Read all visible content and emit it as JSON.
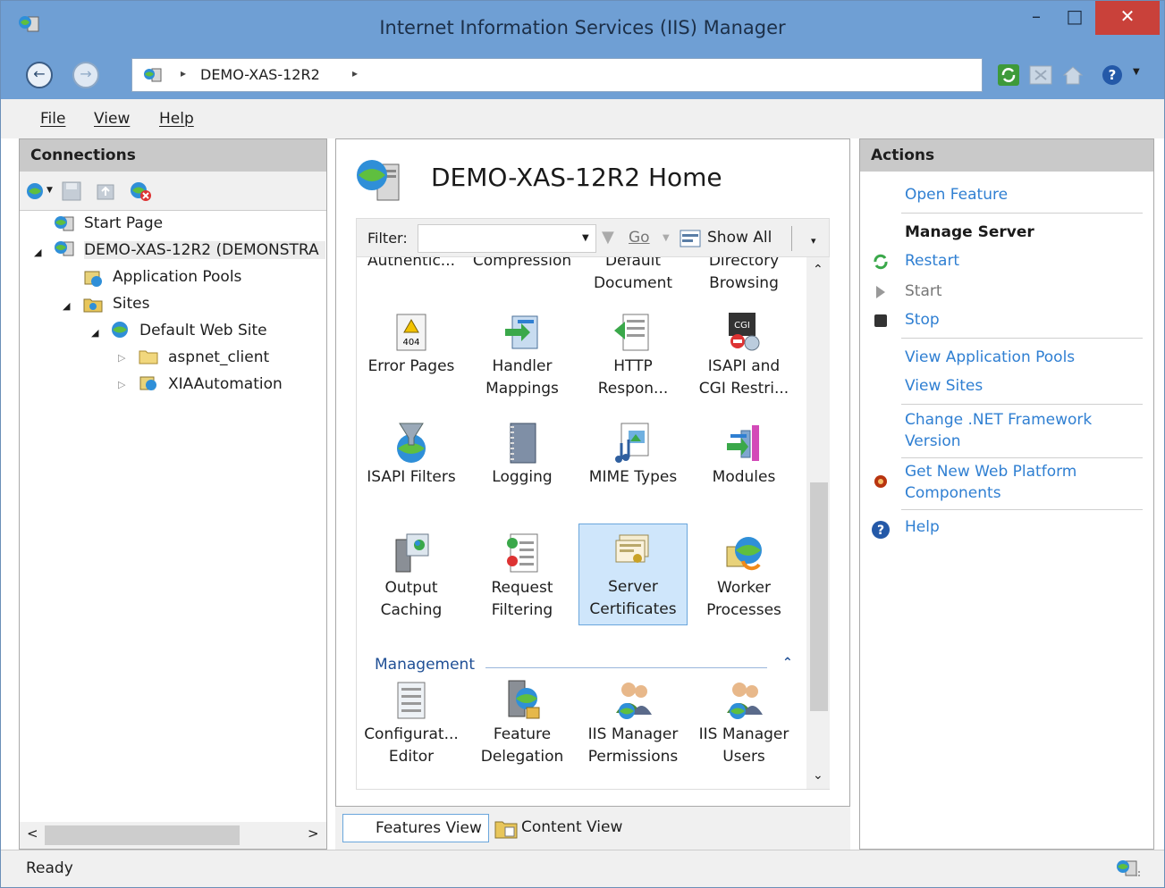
{
  "window": {
    "title": "Internet Information Services (IIS) Manager",
    "min": "–",
    "max": "□",
    "close": "✕"
  },
  "address": {
    "crumb": "DEMO-XAS-12R2",
    "sep1": "▸",
    "sep2": "▸",
    "back": "←",
    "forward": "→"
  },
  "menu": {
    "file": "File",
    "view": "View",
    "help": "Help"
  },
  "connections": {
    "header": "Connections",
    "tree": [
      {
        "label": "Start Page"
      },
      {
        "label": "DEMO-XAS-12R2 (DEMONSTRA"
      },
      {
        "label": "Application Pools"
      },
      {
        "label": "Sites"
      },
      {
        "label": "Default Web Site"
      },
      {
        "label": "aspnet_client"
      },
      {
        "label": "XIAAutomation"
      }
    ],
    "scroll_left": "<",
    "scroll_right": ">"
  },
  "home": {
    "title": "DEMO-XAS-12R2 Home",
    "filter_label": "Filter:",
    "go_label": "Go",
    "show_all_label": "Show All",
    "features": [
      {
        "label1": "Authentic...",
        "label2": ""
      },
      {
        "label1": "Compression",
        "label2": ""
      },
      {
        "label1": "Default",
        "label2": "Document"
      },
      {
        "label1": "Directory",
        "label2": "Browsing"
      },
      {
        "label1": "Error Pages",
        "label2": ""
      },
      {
        "label1": "Handler",
        "label2": "Mappings"
      },
      {
        "label1": "HTTP",
        "label2": "Respon..."
      },
      {
        "label1": "ISAPI and",
        "label2": "CGI Restri..."
      },
      {
        "label1": "ISAPI Filters",
        "label2": ""
      },
      {
        "label1": "Logging",
        "label2": ""
      },
      {
        "label1": "MIME Types",
        "label2": ""
      },
      {
        "label1": "Modules",
        "label2": ""
      },
      {
        "label1": "Output",
        "label2": "Caching"
      },
      {
        "label1": "Request",
        "label2": "Filtering"
      },
      {
        "label1": "Server",
        "label2": "Certificates"
      },
      {
        "label1": "Worker",
        "label2": "Processes"
      }
    ],
    "group": "Management",
    "management": [
      {
        "label1": "Configurat...",
        "label2": "Editor"
      },
      {
        "label1": "Feature",
        "label2": "Delegation"
      },
      {
        "label1": "IIS Manager",
        "label2": "Permissions"
      },
      {
        "label1": "IIS Manager",
        "label2": "Users"
      }
    ]
  },
  "tabs": {
    "features_view": "Features View",
    "content_view": "Content View"
  },
  "actions": {
    "header": "Actions",
    "open_feature": "Open Feature",
    "manage_server": "Manage Server",
    "restart": "Restart",
    "start": "Start",
    "stop": "Stop",
    "view_app_pools": "View Application Pools",
    "view_sites": "View Sites",
    "change_net_1": "Change .NET Framework",
    "change_net_2": "Version",
    "get_new_1": "Get New Web Platform",
    "get_new_2": "Components",
    "help": "Help"
  },
  "status": {
    "text": "Ready"
  }
}
